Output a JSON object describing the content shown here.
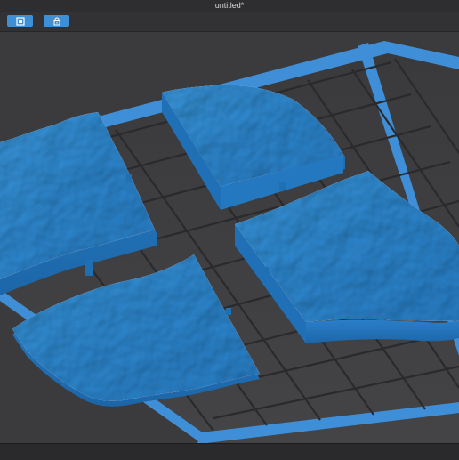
{
  "window": {
    "title": "untitled*"
  },
  "toolbar": {
    "buttons": [
      {
        "icon": "view-cube-icon"
      },
      {
        "icon": "lock-icon"
      }
    ]
  },
  "viewport": {
    "background_color": "#3b3b3d",
    "plate_border_color": "#3f8fd8",
    "grid_color": "#2a2a2c",
    "model_color": "#2e8fd6",
    "model_pieces": [
      "model-piece-top-left",
      "model-piece-top-right",
      "model-piece-bottom-left",
      "model-piece-bottom-right"
    ]
  },
  "colors": {
    "accent": "#3d8fd6",
    "titlebar": "#2e2e30",
    "toolbar": "#323234"
  }
}
